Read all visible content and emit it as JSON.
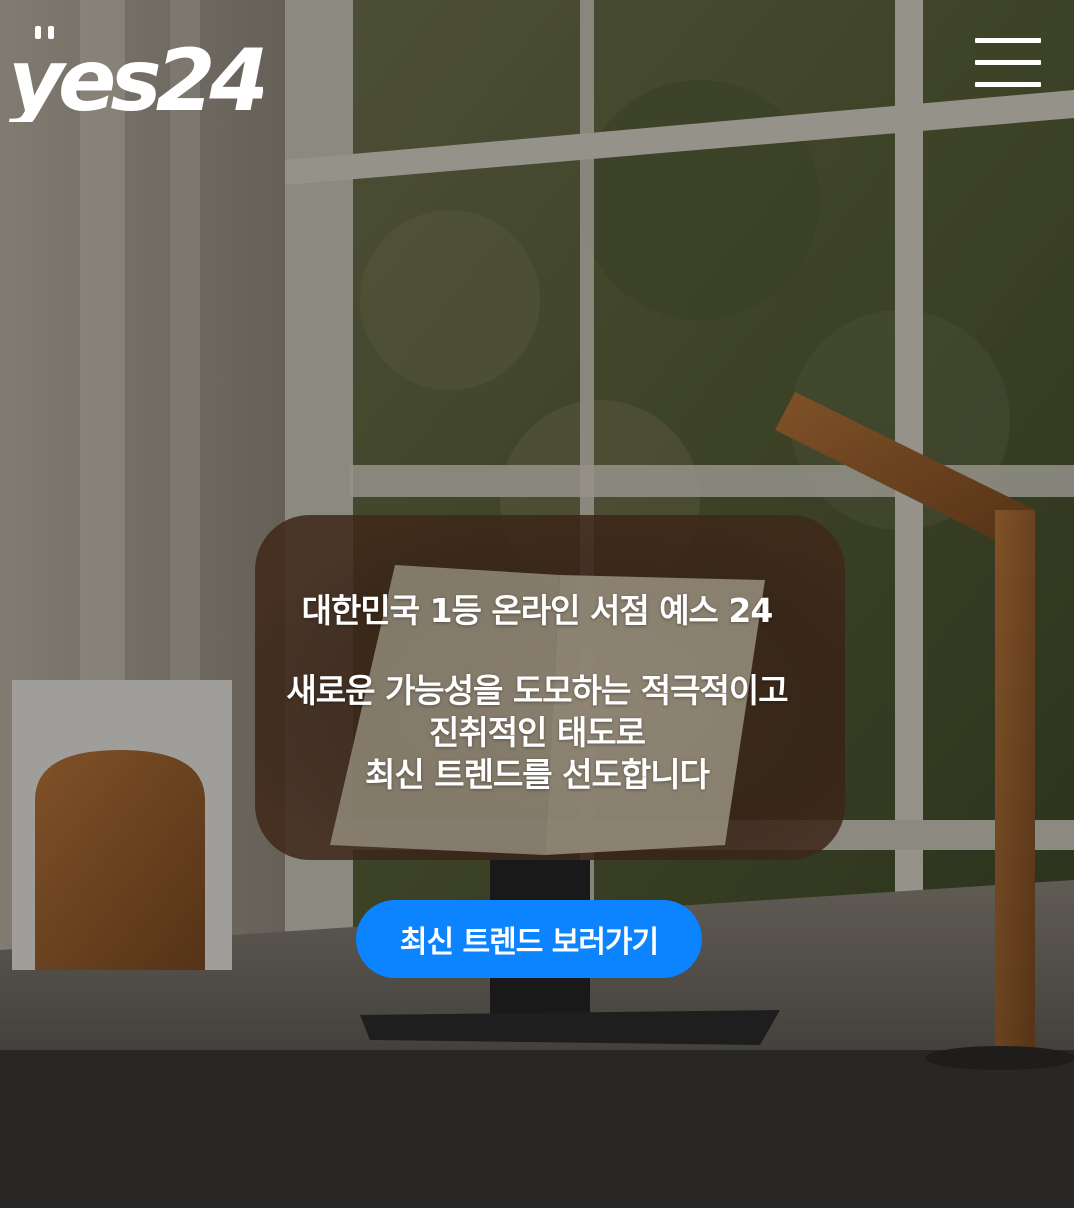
{
  "header": {
    "logo_text": "yes24",
    "menu_icon": "hamburger-menu-icon"
  },
  "hero": {
    "headline": "대한민국 1등 온라인 서점 예스 24",
    "description_lines": [
      "새로운 가능성을 도모하는 적극적이고",
      "진취적인 태도로",
      "최신 트렌드를 선도합니다"
    ],
    "cta_label": "최신 트렌드 보러가기"
  },
  "colors": {
    "accent": "#0c83ff",
    "text": "#ffffff"
  }
}
